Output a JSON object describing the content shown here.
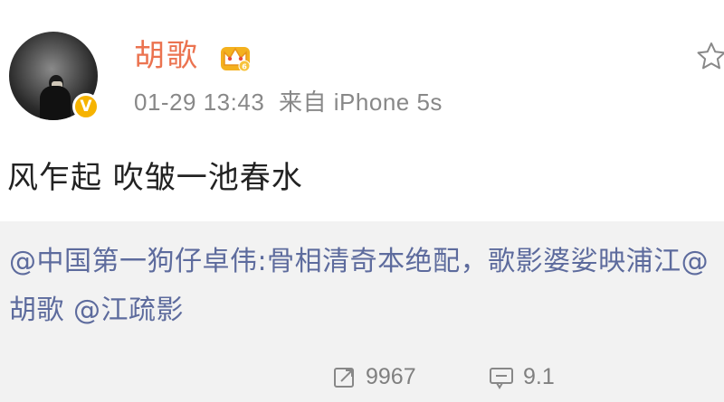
{
  "post": {
    "username": "胡歌",
    "verified_badge": "V",
    "timestamp": "01-29 13:43",
    "source_prefix": "来自",
    "source_device": "iPhone 5s",
    "content": "风乍起 吹皱一池春水"
  },
  "repost": {
    "text": "@中国第一狗仔卓伟:骨相清奇本绝配，歌影婆娑映浦江@胡歌 @江疏影"
  },
  "footer": {
    "forward_count": "9967",
    "comment_count": "9.1"
  },
  "icons": {
    "crown": "crown-icon",
    "star": "star-icon",
    "forward": "forward-icon",
    "comment": "comment-icon"
  },
  "colors": {
    "username": "#eb7350",
    "link": "#5d6b9d",
    "muted": "#888888",
    "badge": "#f6b300",
    "repost_bg": "#f2f2f2"
  }
}
